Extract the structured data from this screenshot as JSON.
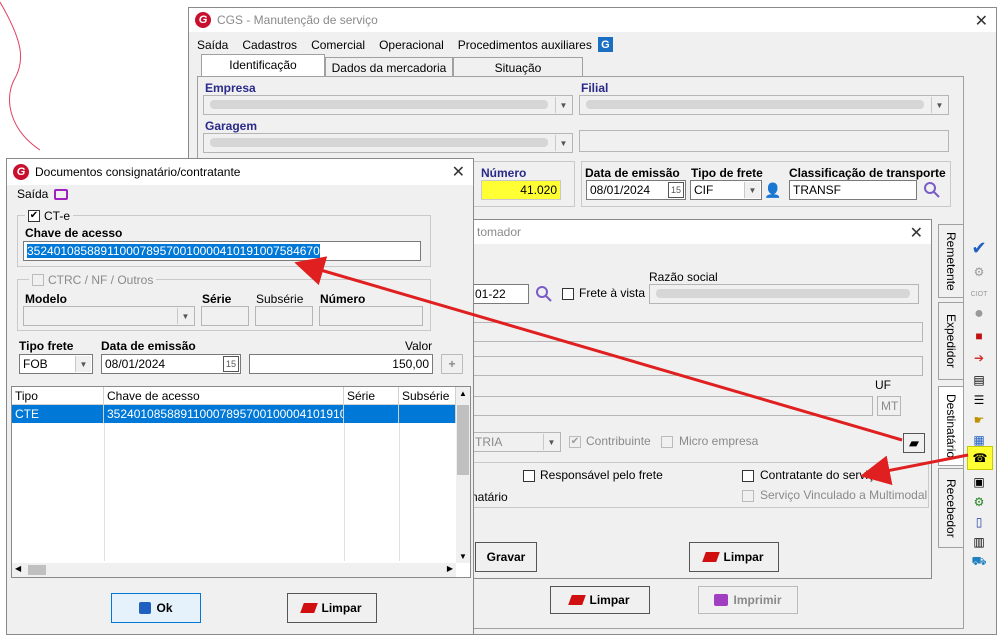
{
  "main": {
    "title": "CGS - Manutenção de serviço",
    "menu": [
      "Saída",
      "Cadastros",
      "Comercial",
      "Operacional",
      "Procedimentos auxiliares"
    ],
    "tabs": [
      "Identificação",
      "Dados da mercadoria",
      "Situação"
    ],
    "empresa_label": "Empresa",
    "filial_label": "Filial",
    "garagem_label": "Garagem",
    "numero_label": "Número",
    "numero_value": "41.020",
    "data_emissao_label": "Data de emissão",
    "data_emissao_value": "08/01/2024",
    "tipo_frete_label": "Tipo de frete",
    "tipo_frete_value": "CIF",
    "classificacao_label": "Classificação de transporte",
    "classificacao_value": "TRANSF",
    "limpar_label": "Limpar",
    "imprimir_label": "Imprimir"
  },
  "tomador": {
    "title": "tomador",
    "date_value": "01-22",
    "frete_vista_label": "Frete à vista",
    "razao_social_label": "Razão social",
    "uf_label": "UF",
    "uf_value": "MT",
    "categoria_value": "TRIA",
    "contribuinte_label": "Contribuinte",
    "micro_empresa_label": "Micro empresa",
    "responsavel_label": "Responsável pelo frete",
    "contratante_label": "Contratante do serviço",
    "vinculado_label": "Serviço Vinculado a Multimodal",
    "natario_label": "natário",
    "gravar_label": "Gravar",
    "limpar_label": "Limpar"
  },
  "side_tabs": [
    "Remetente",
    "Expedidor",
    "Destinatário",
    "Recebedor"
  ],
  "dialog": {
    "title": "Documentos consignatário/contratante",
    "menu_saida": "Saída",
    "cte_label": "CT-e",
    "chave_label": "Chave de acesso",
    "chave_value": "35240108588911000789570010000410191007584670",
    "ctrc_label": "CTRC / NF / Outros",
    "modelo_label": "Modelo",
    "serie_label": "Série",
    "subserie_label": "Subsérie",
    "numero_label": "Número",
    "tipo_frete_label": "Tipo frete",
    "tipo_frete_value": "FOB",
    "data_emissao_label": "Data de emissão",
    "data_emissao_value": "08/01/2024",
    "valor_label": "Valor",
    "valor_value": "150,00",
    "table_headers": [
      "Tipo",
      "Chave de acesso",
      "Série",
      "Subsérie"
    ],
    "table_rows": [
      [
        "CTE",
        "352401085889110007895700100004101910007...",
        "",
        ""
      ]
    ],
    "ok_label": "Ok",
    "limpar_label": "Limpar"
  },
  "colors": {
    "accent": "#0078d7",
    "highlight": "#ffff33",
    "arrow": "#e02020",
    "brand": "#c8102e"
  }
}
